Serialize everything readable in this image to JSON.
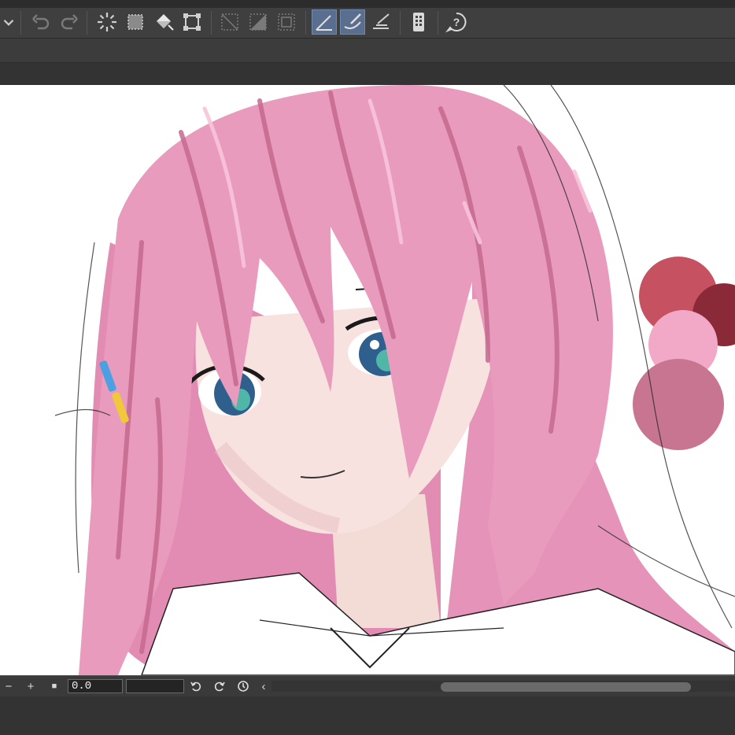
{
  "toolbar": {
    "buttons": [
      {
        "name": "dropdown-arrow-icon"
      },
      {
        "name": "undo-icon"
      },
      {
        "name": "redo-icon"
      },
      {
        "name": "loading-spinner-icon"
      },
      {
        "name": "selection-dotted-icon"
      },
      {
        "name": "fill-bucket-icon"
      },
      {
        "name": "transform-icon"
      },
      {
        "name": "clear-selection-icon"
      },
      {
        "name": "invert-selection-icon"
      },
      {
        "name": "selection-frame-icon"
      },
      {
        "name": "ruler-snap-icon"
      },
      {
        "name": "brush-snap-icon"
      },
      {
        "name": "ruler-edit-icon"
      },
      {
        "name": "device-icon"
      },
      {
        "name": "help-icon"
      }
    ]
  },
  "statusbar": {
    "zoom_out_label": "−",
    "zoom_in_label": "+",
    "fit_label": "■",
    "zoom_value": "0.0",
    "back_label": "‹"
  },
  "colors": {
    "hair": "#e99bbd",
    "hair_shadow": "#c5698f",
    "skin": "#f7e2e0",
    "eye": "#2f5f8c",
    "swatch_dark_red": "#c65261",
    "swatch_maroon": "#8a2a39",
    "swatch_pink": "#f2a9c7",
    "swatch_mauve": "#c77590"
  }
}
